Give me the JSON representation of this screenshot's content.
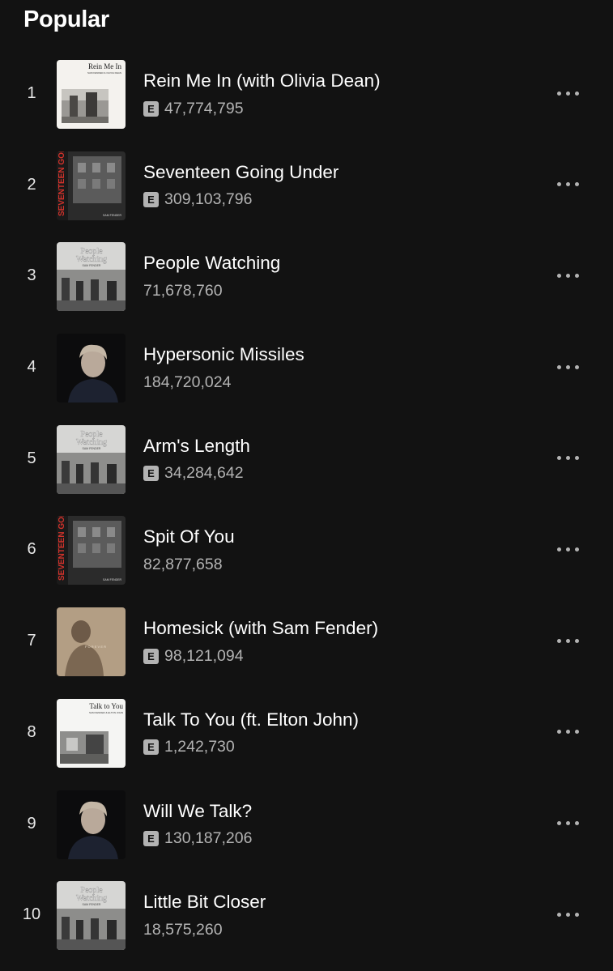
{
  "section": {
    "title": "Popular"
  },
  "tracks": [
    {
      "rank": "1",
      "title": "Rein Me In (with Olivia Dean)",
      "explicit": true,
      "explicit_label": "E",
      "plays": "47,774,795",
      "cover": "rein-me-in",
      "cover_title": "Rein Me In",
      "cover_sub": "SAM FENDER & OLIVIA DEAN"
    },
    {
      "rank": "2",
      "title": "Seventeen Going Under",
      "explicit": true,
      "explicit_label": "E",
      "plays": "309,103,796",
      "cover": "seventeen",
      "cover_title": "SEVENTEEN GOING UNDER",
      "cover_sub": "SAM FENDER"
    },
    {
      "rank": "3",
      "title": "People Watching",
      "explicit": false,
      "explicit_label": "",
      "plays": "71,678,760",
      "cover": "people-watching",
      "cover_title": "People Watching",
      "cover_sub": "SAM FENDER"
    },
    {
      "rank": "4",
      "title": "Hypersonic Missiles",
      "explicit": false,
      "explicit_label": "",
      "plays": "184,720,024",
      "cover": "portrait-dark"
    },
    {
      "rank": "5",
      "title": "Arm's Length",
      "explicit": true,
      "explicit_label": "E",
      "plays": "34,284,642",
      "cover": "people-watching",
      "cover_title": "People Watching",
      "cover_sub": "SAM FENDER"
    },
    {
      "rank": "6",
      "title": "Spit Of You",
      "explicit": false,
      "explicit_label": "",
      "plays": "82,877,658",
      "cover": "seventeen",
      "cover_title": "SEVENTEEN GOING UNDER",
      "cover_sub": "SAM FENDER"
    },
    {
      "rank": "7",
      "title": "Homesick (with Sam Fender)",
      "explicit": true,
      "explicit_label": "E",
      "plays": "98,121,094",
      "cover": "homesick"
    },
    {
      "rank": "8",
      "title": "Talk To You (ft. Elton John)",
      "explicit": true,
      "explicit_label": "E",
      "plays": "1,242,730",
      "cover": "talk-to-you",
      "cover_title": "Talk to You",
      "cover_sub": "SAM FENDER & ELTON JOHN"
    },
    {
      "rank": "9",
      "title": "Will We Talk?",
      "explicit": true,
      "explicit_label": "E",
      "plays": "130,187,206",
      "cover": "portrait-dark"
    },
    {
      "rank": "10",
      "title": "Little Bit Closer",
      "explicit": false,
      "explicit_label": "",
      "plays": "18,575,260",
      "cover": "people-watching",
      "cover_title": "People Watching",
      "cover_sub": "SAM FENDER"
    }
  ],
  "icons": {
    "more": "more-horizontal-icon",
    "explicit": "explicit-icon"
  },
  "colors": {
    "background": "#121212",
    "text_primary": "#ffffff",
    "text_secondary": "#b3b3b3"
  }
}
